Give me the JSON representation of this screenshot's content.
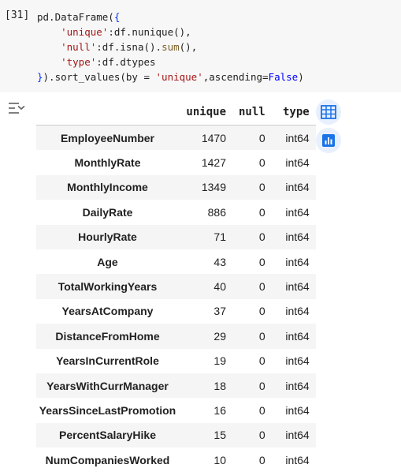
{
  "cell": {
    "execution_count": "[31]",
    "code_lines": [
      "pd.DataFrame({",
      "    'unique':df.nunique(),",
      "    'null':df.isna().sum(),",
      "    'type':df.dtypes",
      "}).sort_values(by = 'unique',ascending=False)"
    ]
  },
  "output": {
    "toolbar": {
      "table_icon": "table-icon",
      "chart_icon": "bar-chart-icon",
      "toggle_icon": "output-toggle-icon"
    },
    "columns": [
      "unique",
      "null",
      "type"
    ],
    "rows": [
      {
        "index": "EmployeeNumber",
        "unique": "1470",
        "null": "0",
        "type": "int64"
      },
      {
        "index": "MonthlyRate",
        "unique": "1427",
        "null": "0",
        "type": "int64"
      },
      {
        "index": "MonthlyIncome",
        "unique": "1349",
        "null": "0",
        "type": "int64"
      },
      {
        "index": "DailyRate",
        "unique": "886",
        "null": "0",
        "type": "int64"
      },
      {
        "index": "HourlyRate",
        "unique": "71",
        "null": "0",
        "type": "int64"
      },
      {
        "index": "Age",
        "unique": "43",
        "null": "0",
        "type": "int64"
      },
      {
        "index": "TotalWorkingYears",
        "unique": "40",
        "null": "0",
        "type": "int64"
      },
      {
        "index": "YearsAtCompany",
        "unique": "37",
        "null": "0",
        "type": "int64"
      },
      {
        "index": "DistanceFromHome",
        "unique": "29",
        "null": "0",
        "type": "int64"
      },
      {
        "index": "YearsInCurrentRole",
        "unique": "19",
        "null": "0",
        "type": "int64"
      },
      {
        "index": "YearsWithCurrManager",
        "unique": "18",
        "null": "0",
        "type": "int64"
      },
      {
        "index": "YearsSinceLastPromotion",
        "unique": "16",
        "null": "0",
        "type": "int64"
      },
      {
        "index": "PercentSalaryHike",
        "unique": "15",
        "null": "0",
        "type": "int64"
      },
      {
        "index": "NumCompaniesWorked",
        "unique": "10",
        "null": "0",
        "type": "int64"
      }
    ]
  }
}
